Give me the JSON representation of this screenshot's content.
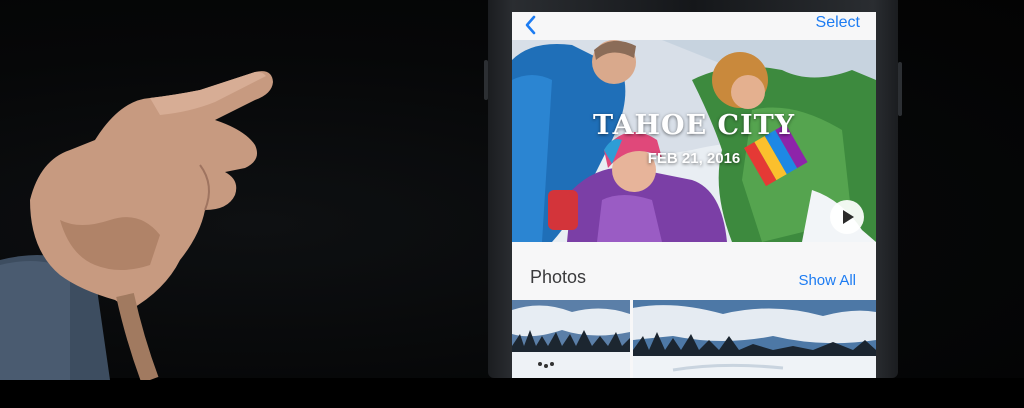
{
  "navigation": {
    "back_icon": "chevron-left-icon",
    "select_label": "Select"
  },
  "memory": {
    "title": "TAHOE CITY",
    "date": "FEB 21, 2016",
    "play_icon": "play-icon"
  },
  "photos_section": {
    "title": "Photos",
    "show_all_label": "Show All"
  },
  "colors": {
    "accent": "#1d7cf2",
    "background": "#f7f7f8",
    "title_text": "#3a3a3c"
  }
}
